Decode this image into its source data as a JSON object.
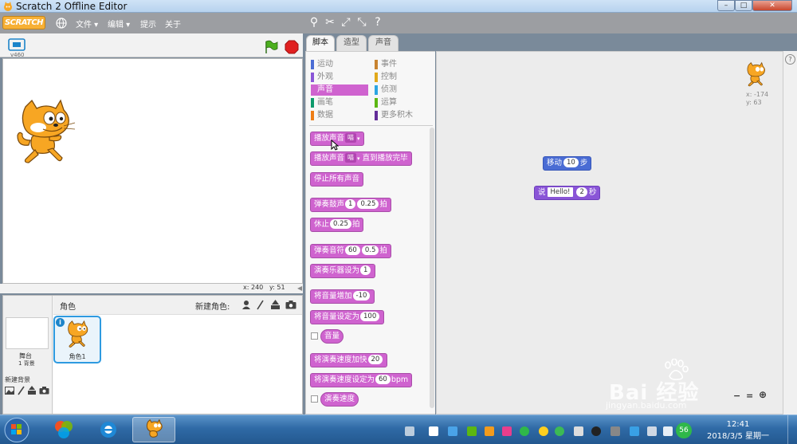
{
  "window": {
    "title": "Scratch 2 Offline Editor",
    "controls": [
      "–",
      "□",
      "✕"
    ]
  },
  "menubar": {
    "logo": "SCRATCH",
    "globe_icon": "globe-icon",
    "items": [
      "文件 ▾",
      "编辑 ▾",
      "提示",
      "关于"
    ],
    "tools": [
      "duplicate-icon",
      "delete-icon",
      "grow-icon",
      "shrink-icon",
      "help-icon"
    ]
  },
  "stage": {
    "version": "v460",
    "mouse_x": "x: 240",
    "mouse_y": "y: 51"
  },
  "sprite_pane": {
    "title": "角色",
    "new_sprite_label": "新建角色:",
    "stage_label": "舞台",
    "backdrop_count": "1 背景",
    "new_backdrop_label": "新建背景",
    "sprites": [
      {
        "name": "角色1"
      }
    ]
  },
  "tabs": [
    "脚本",
    "造型",
    "声音"
  ],
  "categories": [
    {
      "label": "运动",
      "color": "#4a6cd4"
    },
    {
      "label": "事件",
      "color": "#c88330"
    },
    {
      "label": "外观",
      "color": "#8a55d7"
    },
    {
      "label": "控制",
      "color": "#e1a91a"
    },
    {
      "label": "声音",
      "color": "#cf63cf"
    },
    {
      "label": "侦测",
      "color": "#2ca5e2"
    },
    {
      "label": "画笔",
      "color": "#0e9a6c"
    },
    {
      "label": "运算",
      "color": "#5cb712"
    },
    {
      "label": "数据",
      "color": "#ee7d16"
    },
    {
      "label": "更多积木",
      "color": "#632d99"
    }
  ],
  "blocks": {
    "play_sound": {
      "label": "播放声音",
      "opt": "喵"
    },
    "play_sound_until": {
      "label": "播放声音",
      "opt": "喵",
      "suffix": "直到播放完毕"
    },
    "stop_all": {
      "label": "停止所有声音"
    },
    "play_drum": {
      "label": "弹奏鼓声",
      "opt": "1",
      "val": "0.25",
      "suffix": "拍"
    },
    "rest": {
      "label": "休止",
      "val": "0.25",
      "suffix": "拍"
    },
    "play_note": {
      "label": "弹奏音符",
      "opt": "60",
      "val": "0.5",
      "suffix": "拍"
    },
    "set_instrument": {
      "label": "演奏乐器设为",
      "opt": "1"
    },
    "change_volume": {
      "label": "将音量增加",
      "val": "-10"
    },
    "set_volume": {
      "label": "将音量设定为",
      "val": "100"
    },
    "volume": {
      "label": "音量"
    },
    "change_tempo": {
      "label": "将演奏速度加快",
      "val": "20"
    },
    "set_tempo": {
      "label": "将演奏速度设定为",
      "val": "60",
      "suffix": "bpm"
    },
    "tempo": {
      "label": "演奏速度"
    }
  },
  "script_area": {
    "move": {
      "label": "移动",
      "val": "10",
      "suffix": "步"
    },
    "say": {
      "label": "说",
      "text": "Hello!",
      "val": "2",
      "suffix": "秒"
    },
    "sprite_x": "x: -174",
    "sprite_y": "y: 63",
    "zoom_icons": [
      "zoom-out-icon",
      "zoom-reset-icon",
      "zoom-in-icon"
    ]
  },
  "taskbar": {
    "time": "12:41",
    "date": "2018/3/5 星期一",
    "tray_badge": "56"
  },
  "watermark": {
    "brand": "Bai 经验",
    "url": "jingyan.baidu.com"
  },
  "colors": {
    "sound": "#cf63cf",
    "motion": "#4a6cd4",
    "looks": "#8a55d7"
  }
}
